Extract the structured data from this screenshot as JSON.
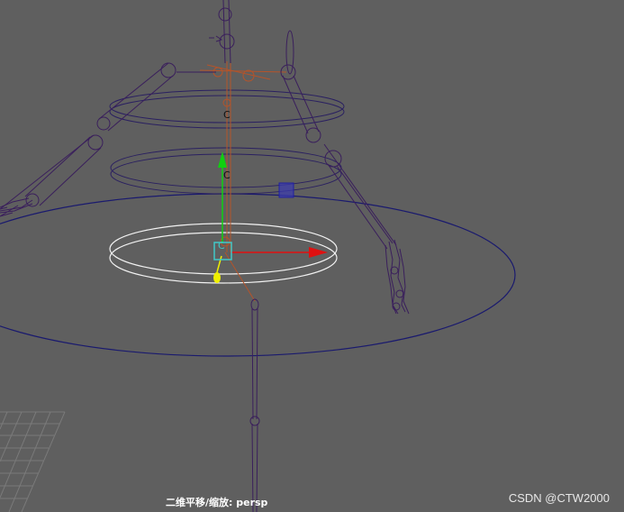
{
  "viewport": {
    "camera_label": "二维平移/缩放: persp",
    "watermark": "CSDN @CTW2000",
    "background_color": "#5f5f5f"
  },
  "controls": {
    "center_marker_letter": "C"
  },
  "colors": {
    "skeleton": "#3a1f5c",
    "joint_orange": "#b5542a",
    "main_ring": "#1a1a6e",
    "selected_ring": "#f2f2f2",
    "ctrl_ring": "#2a2060",
    "axis_x": "#e01010",
    "axis_y": "#10d010",
    "axis_z": "#f0f000",
    "pivot_box": "#40c8c8",
    "blue_cube": "#3030b0"
  }
}
